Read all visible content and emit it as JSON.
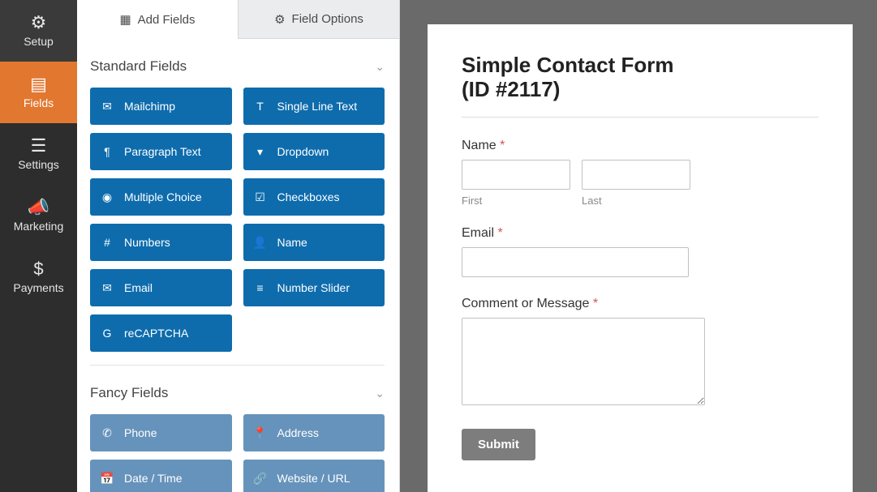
{
  "nav": {
    "items": [
      {
        "icon": "gear-icon",
        "glyph": "⚙",
        "label": "Setup",
        "active": false
      },
      {
        "icon": "list-icon",
        "glyph": "▤",
        "label": "Fields",
        "active": true
      },
      {
        "icon": "sliders-icon",
        "glyph": "☰",
        "label": "Settings",
        "active": false
      },
      {
        "icon": "bullhorn-icon",
        "glyph": "📣",
        "label": "Marketing",
        "active": false
      },
      {
        "icon": "dollar-icon",
        "glyph": "$",
        "label": "Payments",
        "active": false
      }
    ]
  },
  "panel": {
    "tabs": [
      {
        "icon": "layout-icon",
        "glyph": "▦",
        "label": "Add Fields",
        "active": true
      },
      {
        "icon": "sliders-icon",
        "glyph": "⚙",
        "label": "Field Options",
        "active": false
      }
    ],
    "groups": [
      {
        "title": "Standard Fields",
        "open": true,
        "fancy": false,
        "fields": [
          {
            "icon": "envelope-icon",
            "glyph": "✉",
            "label": "Mailchimp"
          },
          {
            "icon": "text-icon",
            "glyph": "T",
            "label": "Single Line Text"
          },
          {
            "icon": "paragraph-icon",
            "glyph": "¶",
            "label": "Paragraph Text"
          },
          {
            "icon": "dropdown-icon",
            "glyph": "▾",
            "label": "Dropdown"
          },
          {
            "icon": "radio-icon",
            "glyph": "◉",
            "label": "Multiple Choice"
          },
          {
            "icon": "checkbox-icon",
            "glyph": "☑",
            "label": "Checkboxes"
          },
          {
            "icon": "hash-icon",
            "glyph": "#",
            "label": "Numbers"
          },
          {
            "icon": "user-icon",
            "glyph": "👤",
            "label": "Name"
          },
          {
            "icon": "envelope-icon",
            "glyph": "✉",
            "label": "Email"
          },
          {
            "icon": "slider-icon",
            "glyph": "≡",
            "label": "Number Slider"
          },
          {
            "icon": "recaptcha-icon",
            "glyph": "G",
            "label": "reCAPTCHA"
          }
        ]
      },
      {
        "title": "Fancy Fields",
        "open": true,
        "fancy": true,
        "fields": [
          {
            "icon": "phone-icon",
            "glyph": "✆",
            "label": "Phone"
          },
          {
            "icon": "pin-icon",
            "glyph": "📍",
            "label": "Address"
          },
          {
            "icon": "calendar-icon",
            "glyph": "📅",
            "label": "Date / Time"
          },
          {
            "icon": "link-icon",
            "glyph": "🔗",
            "label": "Website / URL"
          }
        ]
      }
    ]
  },
  "preview": {
    "title_line1": "Simple Contact Form",
    "title_line2": "(ID #2117)",
    "name_label": "Name",
    "first_sub": "First",
    "last_sub": "Last",
    "email_label": "Email",
    "message_label": "Comment or Message",
    "required_mark": "*",
    "submit_label": "Submit"
  }
}
